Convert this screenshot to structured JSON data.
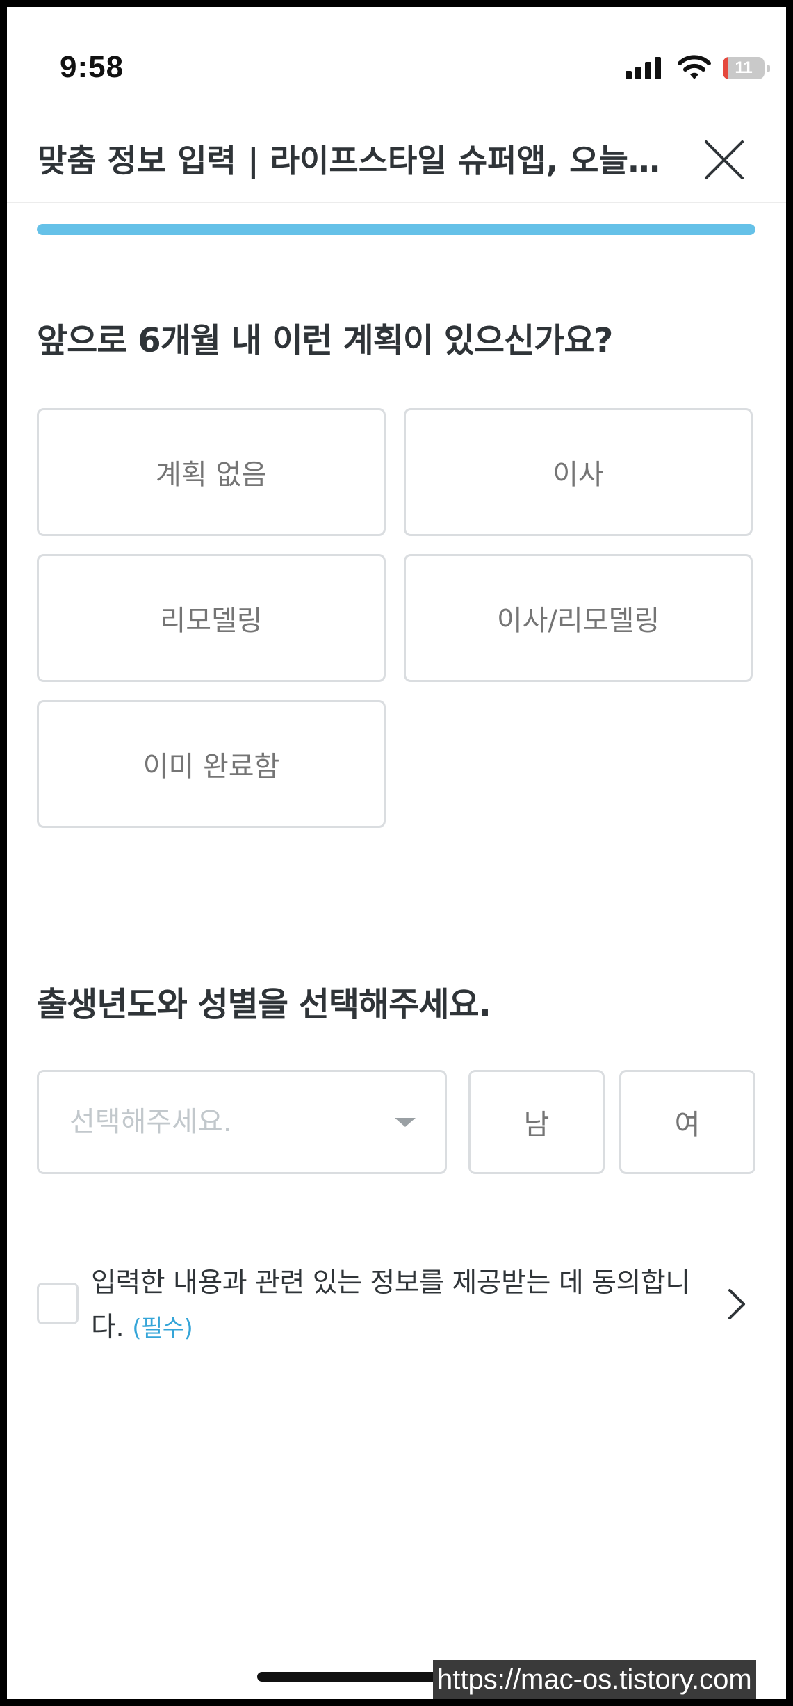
{
  "status_bar": {
    "time": "9:58",
    "battery_level": "11",
    "battery_fraction": 0.11,
    "icons": [
      "cellular-signal-icon",
      "wifi-icon",
      "battery-icon"
    ]
  },
  "header": {
    "title": "맞춤 정보 입력 | 라이프스타일 슈퍼앱, 오늘…",
    "close_icon": "close-icon"
  },
  "progress": {
    "fraction": 1.0
  },
  "plan_question": {
    "title": "앞으로 6개월 내 이런 계획이 있으신가요?",
    "options": [
      "계획 없음",
      "이사",
      "리모델링",
      "이사/리모델링",
      "이미 완료함"
    ]
  },
  "profile_question": {
    "title": "출생년도와 성별을 선택해주세요.",
    "birth_year_placeholder": "선택해주세요.",
    "gender_options": [
      "남",
      "여"
    ]
  },
  "consent": {
    "text": "입력한 내용과 관련 있는 정보를 제공받는 데 동의합니다.",
    "required_label": "(필수)",
    "checked": false
  },
  "watermark": "https://mac-os.tistory.com",
  "colors": {
    "accent": "#65c1e8",
    "required": "#35a5d8",
    "title_text": "#2f3438",
    "option_text": "#757575",
    "border": "#dadde0",
    "battery_low": "#e5483d"
  }
}
